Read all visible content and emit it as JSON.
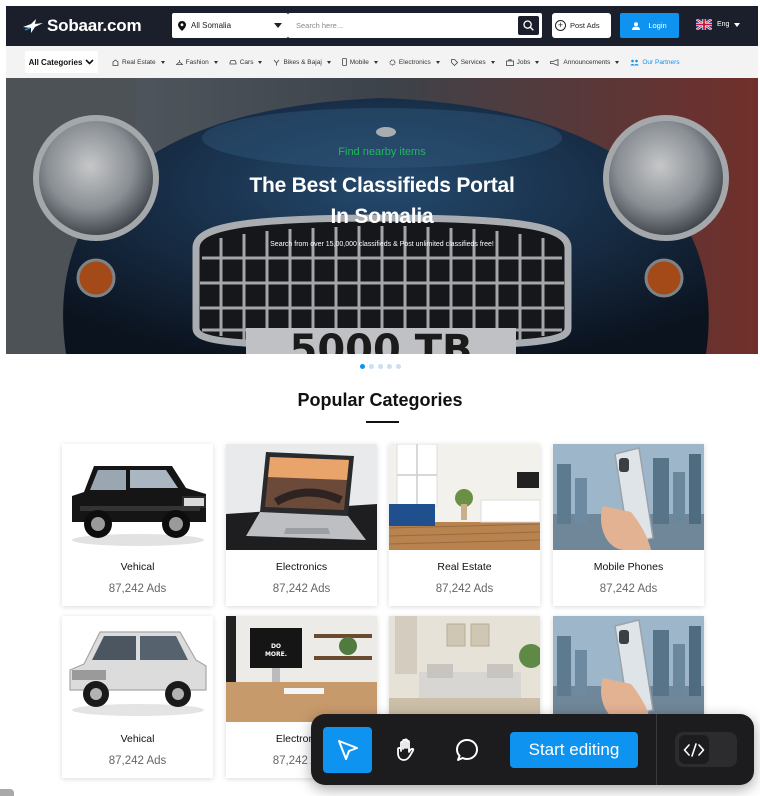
{
  "header": {
    "logo_text": "Sobaar.com",
    "location": "All Somalia",
    "search_placeholder": "Search here...",
    "post_ads": "Post Ads",
    "login": "Login",
    "language": "Eng"
  },
  "nav": {
    "all_categories": "All Categories",
    "items": [
      {
        "label": "Real Estate",
        "icon": "building-icon"
      },
      {
        "label": "Fashion",
        "icon": "hanger-icon"
      },
      {
        "label": "Cars",
        "icon": "car-icon"
      },
      {
        "label": "Bikes & Bajaj",
        "icon": "bike-icon"
      },
      {
        "label": "Mobile",
        "icon": "phone-icon"
      },
      {
        "label": "Electronics",
        "icon": "gear-icon"
      },
      {
        "label": "Services",
        "icon": "tag-icon"
      },
      {
        "label": "Jobs",
        "icon": "briefcase-icon"
      },
      {
        "label": "Announcements",
        "icon": "megaphone-icon"
      }
    ],
    "partners": "Our Partners"
  },
  "hero": {
    "eyebrow": "Find nearby items",
    "title_line1": "The Best Classifieds Portal",
    "title_line2": "In Somalia",
    "subtitle": "Search from over 15,00,000 classifieds & Post unlimited classifieds free!",
    "plate": "5000 TB",
    "slides": 5,
    "active_slide": 1
  },
  "section": {
    "title": "Popular Categories"
  },
  "categories": [
    {
      "name": "Vehical",
      "count": "87,242 Ads"
    },
    {
      "name": "Electronics",
      "count": "87,242 Ads"
    },
    {
      "name": "Real Estate",
      "count": "87,242 Ads"
    },
    {
      "name": "Mobile Phones",
      "count": "87,242 Ads"
    },
    {
      "name": "Vehical",
      "count": "87,242 Ads"
    },
    {
      "name": "Electronics",
      "count": "87,242 Ads"
    },
    {
      "name": "",
      "count": ""
    },
    {
      "name": "",
      "count": ""
    }
  ],
  "toolbar": {
    "start_editing": "Start editing"
  },
  "colors": {
    "brand_blue": "#0f93f0",
    "header_dark": "#1b1f2c",
    "eyebrow_green": "#1fb85a"
  }
}
